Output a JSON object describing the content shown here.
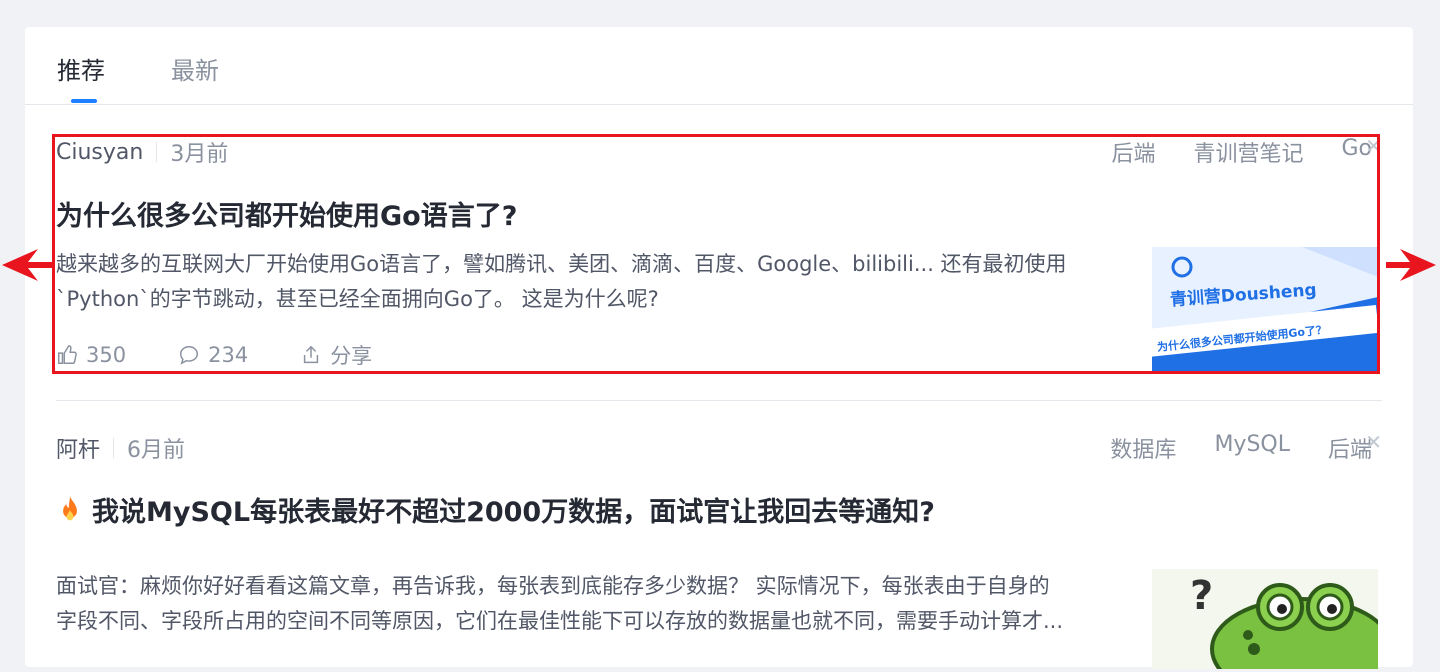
{
  "tabs": [
    {
      "label": "推荐",
      "active": true
    },
    {
      "label": "最新",
      "active": false
    }
  ],
  "articles": [
    {
      "author": "Ciusyan",
      "time": "3月前",
      "tags": [
        "后端",
        "青训营笔记",
        "Go"
      ],
      "title": "为什么很多公司都开始使用Go语言了?",
      "abstract_line1": "越来越多的互联网大厂开始使用Go语言了，譬如腾讯、美团、滴滴、百度、Google、bilibili... 还有最初使用",
      "abstract_line2": "`Python`的字节跳动，甚至已经全面拥向Go了。 这是为什么呢?",
      "likes": "350",
      "comments": "234",
      "share": "分享",
      "thumb_brand": "青训营Dousheng",
      "thumb_caption": "为什么很多公司都开始使用Go了？"
    },
    {
      "author": "阿杆",
      "time": "6月前",
      "tags": [
        "数据库",
        "MySQL",
        "后端"
      ],
      "hot_icon": "fire-icon",
      "title": "我说MySQL每张表最好不超过2000万数据，面试官让我回去等通知?",
      "abstract_line1": "面试官：麻烦你好好看看这篇文章，再告诉我，每张表到底能存多少数据？ 实际情况下，每张表由于自身的",
      "abstract_line2": "字段不同、字段所占用的空间不同等原因，它们在最佳性能下可以存放的数据量也就不同，需要手动计算才..."
    }
  ],
  "colors": {
    "accent": "#1e80ff",
    "highlight": "#e8141e",
    "background": "#f1f2f5"
  }
}
